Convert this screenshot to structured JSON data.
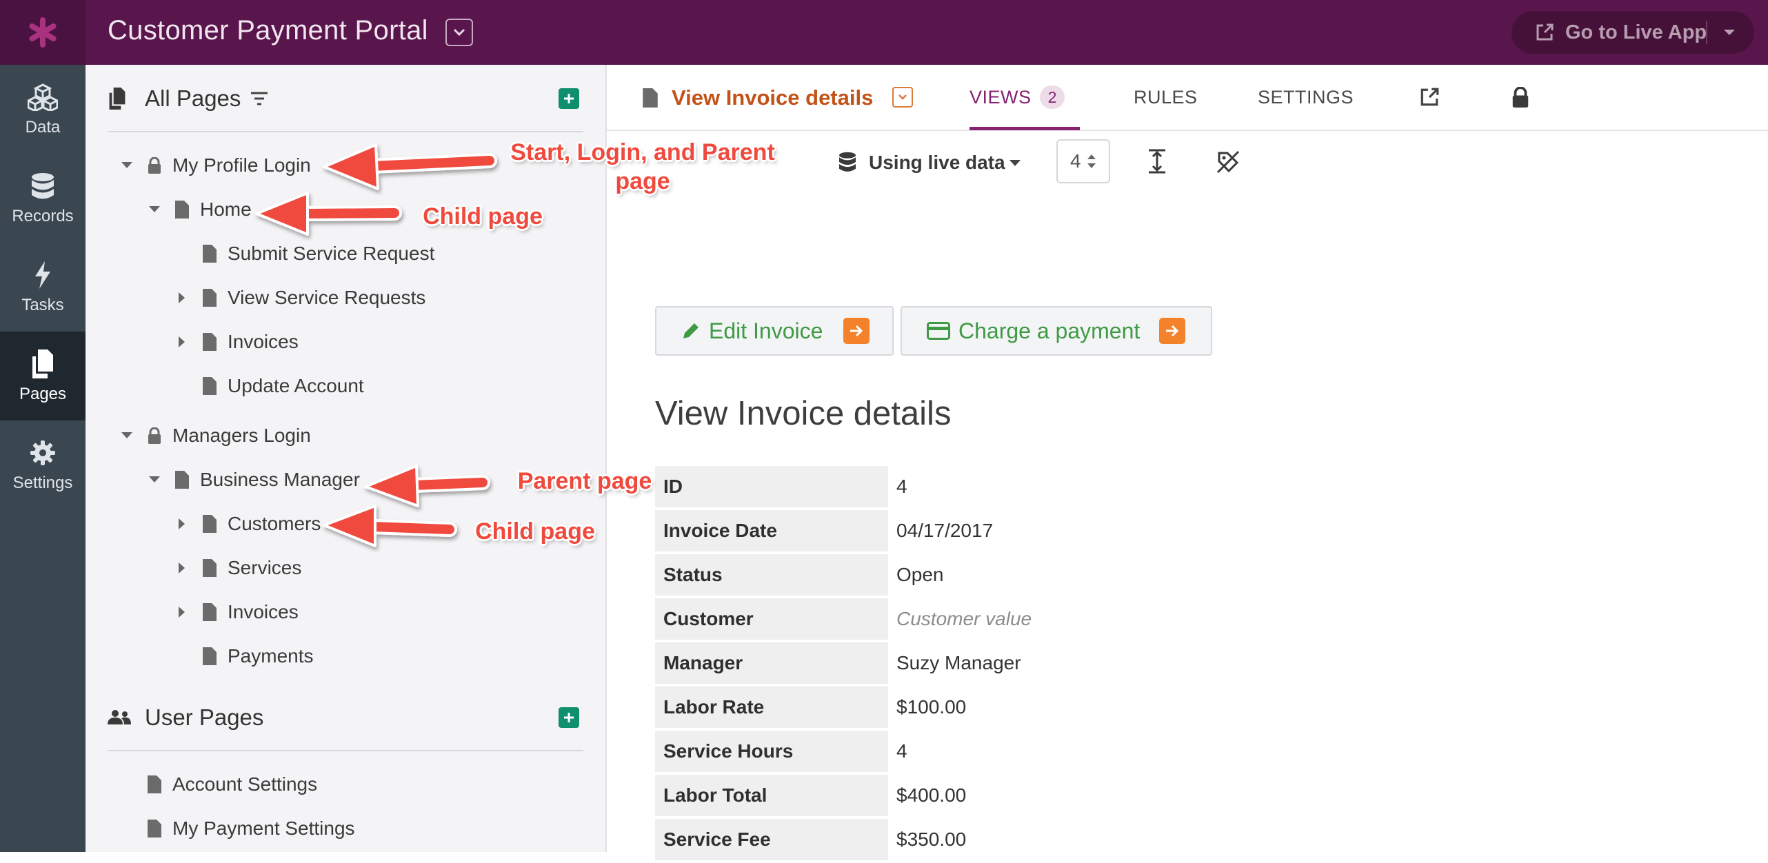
{
  "app": {
    "title": "Customer Payment Portal",
    "live_button": "Go to Live App"
  },
  "left_nav": [
    {
      "label": "Data",
      "icon": "cubes-icon"
    },
    {
      "label": "Records",
      "icon": "database-icon"
    },
    {
      "label": "Tasks",
      "icon": "bolt-icon"
    },
    {
      "label": "Pages",
      "icon": "pages-icon",
      "active": true
    },
    {
      "label": "Settings",
      "icon": "gear-icon"
    }
  ],
  "pages_panel": {
    "all_pages_title": "All Pages",
    "user_pages_title": "User Pages",
    "tree": [
      {
        "label": "My Profile Login",
        "type": "login"
      },
      {
        "label": "Home",
        "type": "page"
      },
      {
        "label": "Submit Service Request",
        "type": "page"
      },
      {
        "label": "View Service Requests",
        "type": "page"
      },
      {
        "label": "Invoices",
        "type": "page"
      },
      {
        "label": "Update Account",
        "type": "page"
      },
      {
        "label": "Managers Login",
        "type": "login"
      },
      {
        "label": "Business Manager",
        "type": "page"
      },
      {
        "label": "Customers",
        "type": "page"
      },
      {
        "label": "Services",
        "type": "page"
      },
      {
        "label": "Invoices",
        "type": "page"
      },
      {
        "label": "Payments",
        "type": "page"
      }
    ],
    "user_pages": [
      {
        "label": "Account Settings"
      },
      {
        "label": "My Payment Settings"
      }
    ]
  },
  "page_tabs": {
    "page_name": "View Invoice details",
    "views_label": "VIEWS",
    "views_count": "2",
    "rules_label": "RULES",
    "settings_label": "SETTINGS"
  },
  "toolbar": {
    "data_label": "Using live data",
    "record_number": "4"
  },
  "actions": {
    "edit_invoice": "Edit Invoice",
    "charge_payment": "Charge a payment"
  },
  "details": {
    "heading": "View Invoice details",
    "rows": [
      {
        "key": "ID",
        "value": "4"
      },
      {
        "key": "Invoice Date",
        "value": "04/17/2017"
      },
      {
        "key": "Status",
        "value": "Open"
      },
      {
        "key": "Customer",
        "value": "Customer value"
      },
      {
        "key": "Manager",
        "value": "Suzy Manager"
      },
      {
        "key": "Labor Rate",
        "value": "$100.00"
      },
      {
        "key": "Service Hours",
        "value": "4"
      },
      {
        "key": "Labor Total",
        "value": "$400.00"
      },
      {
        "key": "Service Fee",
        "value": "$350.00"
      }
    ]
  },
  "annotations": {
    "start_login_parent": "Start, Login, and Parent page",
    "child_page_1": "Child page",
    "parent_page": "Parent page",
    "child_page_2": "Child page"
  },
  "colors": {
    "topbar": "#59164c",
    "accent": "#86236f",
    "page_name": "#c35216",
    "button_text": "#3f9a46",
    "arrow_badge": "#f3822b",
    "add_button": "#108f6e",
    "annotation": "#f0493d"
  }
}
